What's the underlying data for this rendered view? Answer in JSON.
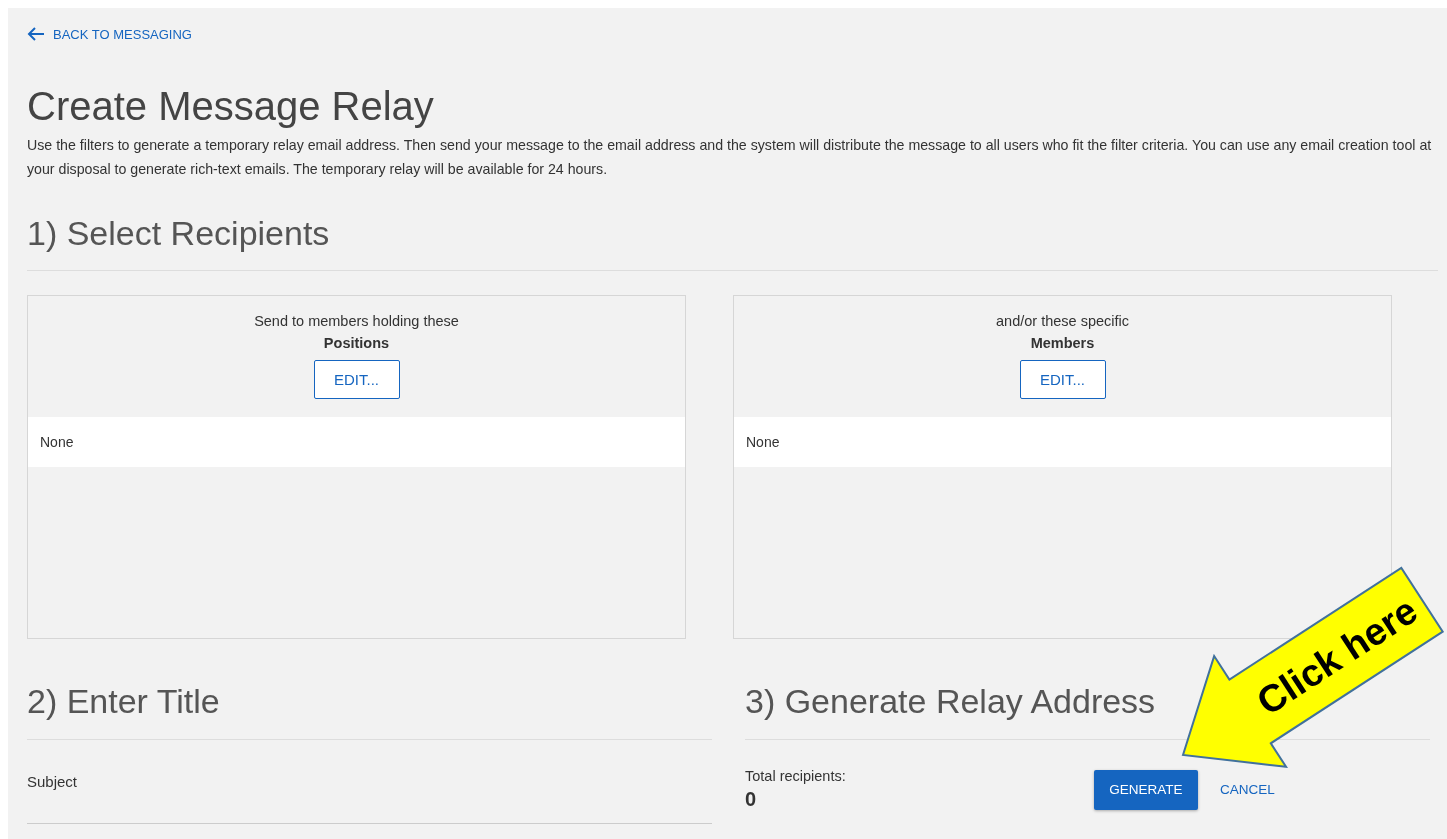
{
  "back_link": {
    "label": "BACK TO MESSAGING"
  },
  "title": "Create Message Relay",
  "description": "Use the filters to generate a temporary relay email address. Then send your message to the email address and the system will distribute the message to all users who fit the filter criteria. You can use any email creation tool at your disposal to generate rich-text emails. The temporary relay will be available for 24 hours.",
  "recipients": {
    "heading": "1) Select Recipients",
    "panels": [
      {
        "caption": "Send to members holding these",
        "label": "Positions",
        "button": "EDIT...",
        "items": [
          "None"
        ]
      },
      {
        "caption": "and/or these specific",
        "label": "Members",
        "button": "EDIT...",
        "items": [
          "None"
        ]
      }
    ]
  },
  "title_section": {
    "heading": "2) Enter Title",
    "field_label": "Subject"
  },
  "generate_section": {
    "heading": "3) Generate Relay Address",
    "total_label": "Total recipients:",
    "total_value": "0",
    "generate_button": "GENERATE",
    "cancel_button": "CANCEL"
  },
  "callout": {
    "text": "Click here"
  }
}
